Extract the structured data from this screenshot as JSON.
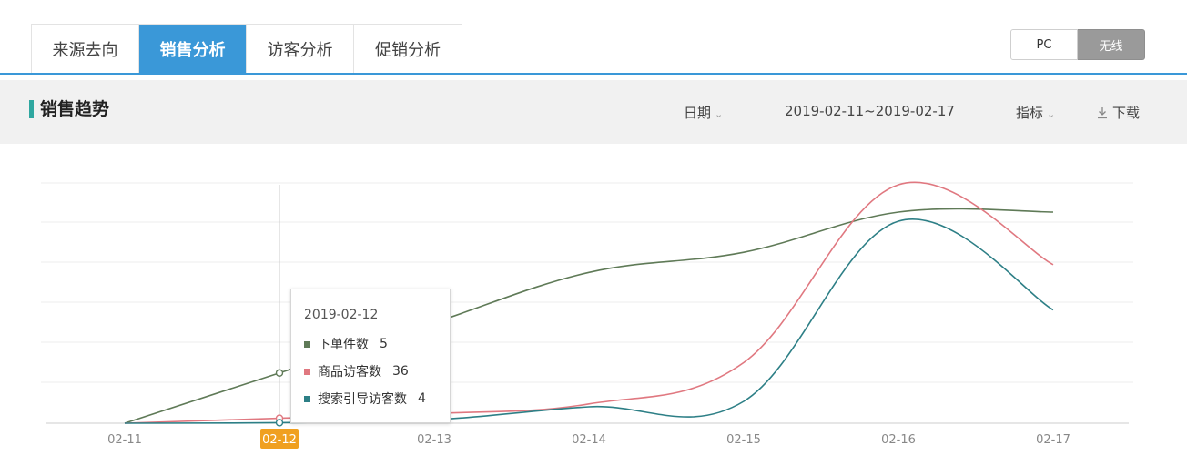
{
  "tabs": [
    {
      "label": "来源去向",
      "active": false
    },
    {
      "label": "销售分析",
      "active": true
    },
    {
      "label": "访客分析",
      "active": false
    },
    {
      "label": "促销分析",
      "active": false
    }
  ],
  "device_toggle": {
    "pc": "PC",
    "wireless": "无线",
    "selected": "无线"
  },
  "section": {
    "title": "销售趋势",
    "date_dropdown": "日期",
    "date_range": "2019-02-11~2019-02-17",
    "metric_dropdown": "指标",
    "download_label": "下载"
  },
  "tooltip": {
    "date": "2019-02-12",
    "rows": [
      {
        "name": "下单件数",
        "value": "5"
      },
      {
        "name": "商品访客数",
        "value": "36"
      },
      {
        "name": "搜索引导访客数",
        "value": "4"
      }
    ]
  },
  "colors": {
    "accent": "#3a98d8",
    "orders": "#5f7a57",
    "visitors": "#e07880",
    "search": "#2d7f86",
    "highlight": "#f0a020"
  },
  "chart_data": {
    "type": "line",
    "categories": [
      "02-11",
      "02-12",
      "02-13",
      "02-14",
      "02-15",
      "02-16",
      "02-17"
    ],
    "highlighted_category": "02-12",
    "series": [
      {
        "name": "下单件数",
        "values": [
          0,
          5,
          10,
          15,
          17,
          21,
          21
        ]
      },
      {
        "name": "商品访客数",
        "values": [
          0,
          36,
          70,
          140,
          440,
          1730,
          1150
        ]
      },
      {
        "name": "搜索引导访客数",
        "values": [
          0,
          4,
          25,
          120,
          160,
          1480,
          830
        ]
      }
    ],
    "grid": true
  }
}
